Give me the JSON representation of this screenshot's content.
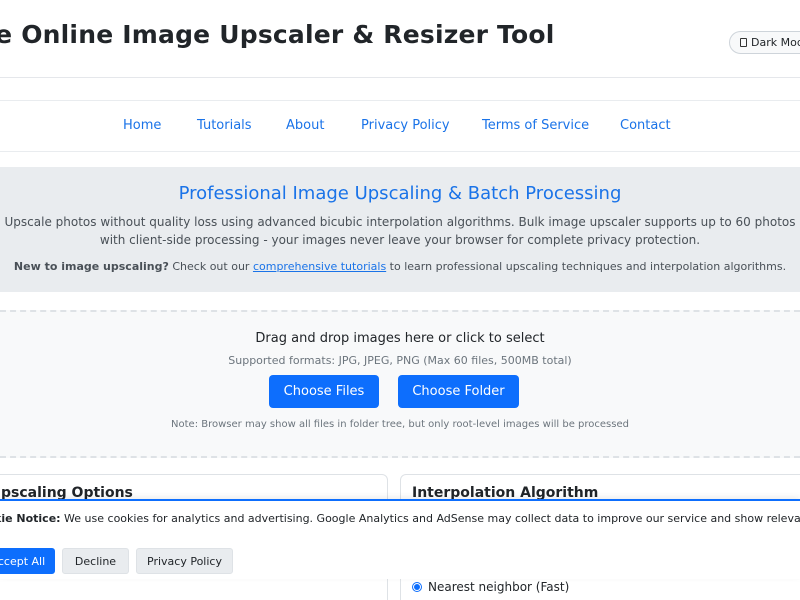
{
  "header": {
    "title": "ee Online Image Upscaler & Resizer Tool",
    "dark_mode_label": "Dark Mode"
  },
  "nav": {
    "items": [
      {
        "label": "Home"
      },
      {
        "label": "Tutorials"
      },
      {
        "label": "About"
      },
      {
        "label": "Privacy Policy"
      },
      {
        "label": "Terms of Service"
      },
      {
        "label": "Contact"
      }
    ]
  },
  "hero": {
    "heading": "Professional Image Upscaling & Batch Processing",
    "description": "Upscale photos without quality loss using advanced bicubic interpolation algorithms. Bulk image upscaler supports up to 60 photos with client-side processing - your images never leave your browser for complete privacy protection.",
    "newbie_bold": "New to image upscaling?",
    "newbie_pre": " Check out our ",
    "newbie_link": "comprehensive tutorials",
    "newbie_post": " to learn professional upscaling techniques and interpolation algorithms."
  },
  "upload": {
    "drag_text": "Drag and drop images here or click to select",
    "formats": "Supported formats: JPG, JPEG, PNG (Max 60 files, 500MB total)",
    "choose_files": "Choose Files",
    "choose_folder": "Choose Folder",
    "note": "Note: Browser may show all files in folder tree, but only root-level images will be processed"
  },
  "panels": {
    "left_title": "pscaling Options",
    "right_title": "Interpolation Algorithm",
    "radio_label": "Nearest neighbor (Fast)"
  },
  "cookie": {
    "bold": "kie Notice:",
    "text": " We use cookies for analytics and advertising. Google Analytics and AdSense may collect data to improve our service and show relevant",
    "accept": "ccept All",
    "decline": "Decline",
    "privacy": "Privacy Policy"
  },
  "colors": {
    "accent": "#0d6efd",
    "link": "#1a73e8",
    "hero_bg": "#e9ecef"
  }
}
